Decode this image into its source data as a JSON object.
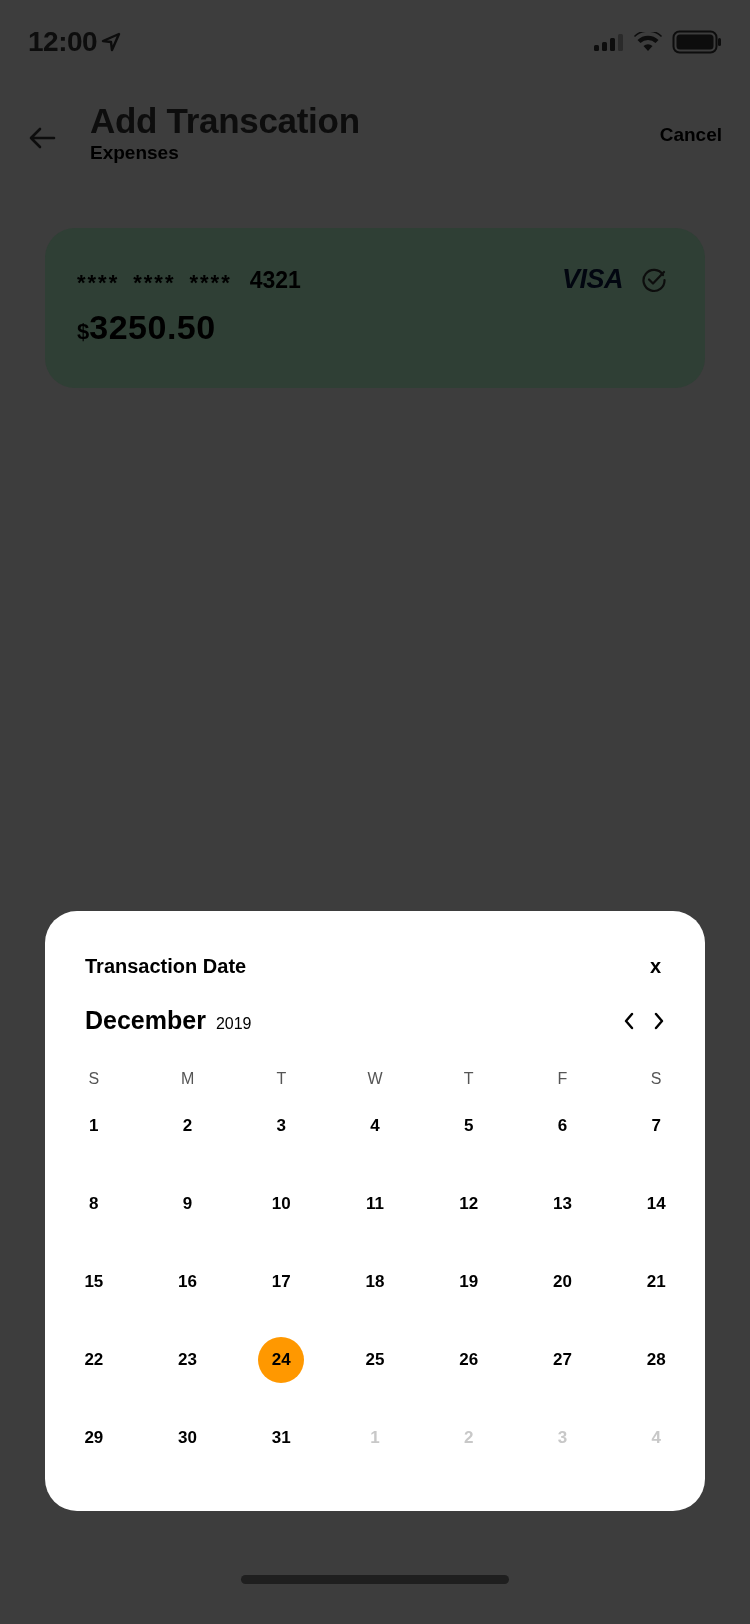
{
  "status_bar": {
    "time": "12:00"
  },
  "header": {
    "title": "Add Transcation",
    "subtitle": "Expenses",
    "action": "Cancel"
  },
  "card": {
    "masked_number": [
      "****",
      "****",
      "****"
    ],
    "last_digits": "4321",
    "currency": "$",
    "balance": "3250.50",
    "brand": "VISA",
    "selected": true
  },
  "date_picker": {
    "title": "Transaction Date",
    "close": "x",
    "month": "December",
    "year": "2019",
    "weekdays": [
      "S",
      "M",
      "T",
      "W",
      "T",
      "F",
      "S"
    ],
    "days": [
      {
        "label": "1",
        "selected": false,
        "muted": false
      },
      {
        "label": "2",
        "selected": false,
        "muted": false
      },
      {
        "label": "3",
        "selected": false,
        "muted": false
      },
      {
        "label": "4",
        "selected": false,
        "muted": false
      },
      {
        "label": "5",
        "selected": false,
        "muted": false
      },
      {
        "label": "6",
        "selected": false,
        "muted": false
      },
      {
        "label": "7",
        "selected": false,
        "muted": false
      },
      {
        "label": "8",
        "selected": false,
        "muted": false
      },
      {
        "label": "9",
        "selected": false,
        "muted": false
      },
      {
        "label": "10",
        "selected": false,
        "muted": false
      },
      {
        "label": "11",
        "selected": false,
        "muted": false
      },
      {
        "label": "12",
        "selected": false,
        "muted": false
      },
      {
        "label": "13",
        "selected": false,
        "muted": false
      },
      {
        "label": "14",
        "selected": false,
        "muted": false
      },
      {
        "label": "15",
        "selected": false,
        "muted": false
      },
      {
        "label": "16",
        "selected": false,
        "muted": false
      },
      {
        "label": "17",
        "selected": false,
        "muted": false
      },
      {
        "label": "18",
        "selected": false,
        "muted": false
      },
      {
        "label": "19",
        "selected": false,
        "muted": false
      },
      {
        "label": "20",
        "selected": false,
        "muted": false
      },
      {
        "label": "21",
        "selected": false,
        "muted": false
      },
      {
        "label": "22",
        "selected": false,
        "muted": false
      },
      {
        "label": "23",
        "selected": false,
        "muted": false
      },
      {
        "label": "24",
        "selected": true,
        "muted": false
      },
      {
        "label": "25",
        "selected": false,
        "muted": false
      },
      {
        "label": "26",
        "selected": false,
        "muted": false
      },
      {
        "label": "27",
        "selected": false,
        "muted": false
      },
      {
        "label": "28",
        "selected": false,
        "muted": false
      },
      {
        "label": "29",
        "selected": false,
        "muted": false
      },
      {
        "label": "30",
        "selected": false,
        "muted": false
      },
      {
        "label": "31",
        "selected": false,
        "muted": false
      },
      {
        "label": "1",
        "selected": false,
        "muted": true
      },
      {
        "label": "2",
        "selected": false,
        "muted": true
      },
      {
        "label": "3",
        "selected": false,
        "muted": true
      },
      {
        "label": "4",
        "selected": false,
        "muted": true
      }
    ]
  }
}
